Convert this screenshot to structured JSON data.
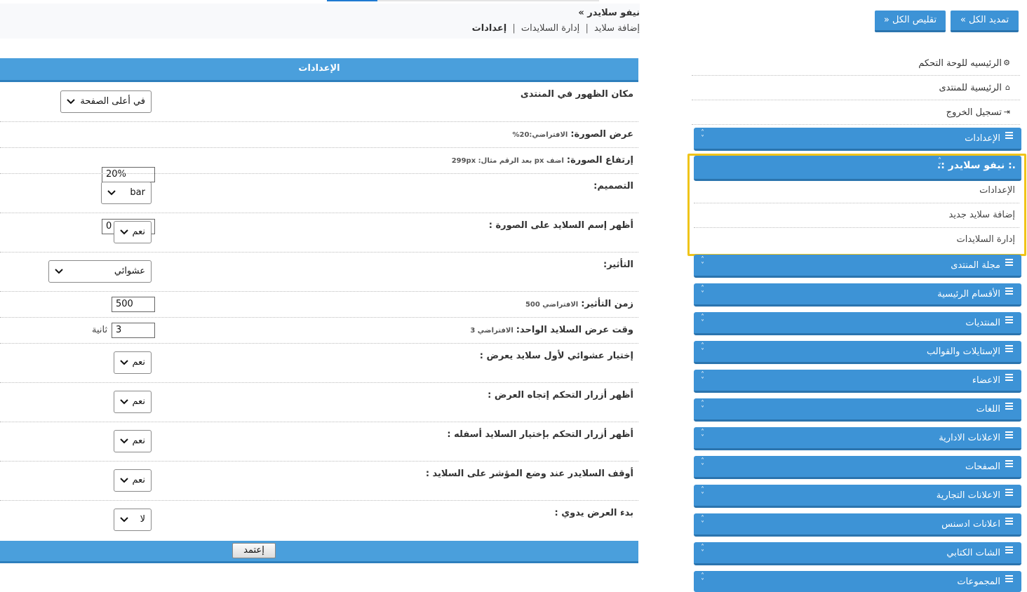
{
  "breadcrumb": {
    "title": "نيفو سلايدر »",
    "links": [
      "إضافة سلايد",
      "إدارة السلايدات"
    ],
    "separator": "|",
    "current": "إعدادات"
  },
  "panel": {
    "header": "الإعدادات",
    "submit_label": "إعتمد"
  },
  "settings": {
    "position": {
      "label": "مكان الظهور في المنتدى",
      "value": "في أعلى الصفحة"
    },
    "image_width": {
      "label": "عرض الصورة:",
      "hint": "الافتراضي:20%",
      "value": "20%"
    },
    "image_height": {
      "label": "إرتفاع الصورة:",
      "hint": "اضف px بعد الرقم مثال: 299px",
      "value": "0"
    },
    "design": {
      "label": "التصميم:",
      "value": "bar"
    },
    "show_name": {
      "label": "أظهر إسم السلايد على الصورة :",
      "value": "نعم"
    },
    "effect": {
      "label": "التأثير:",
      "value": "عشوائي"
    },
    "effect_time": {
      "label": "زمن التأثير:",
      "hint": "الافتراضي 500",
      "value": "500"
    },
    "slide_time": {
      "label": "وقت عرض السلايد الواحد:",
      "hint": "الافتراضي 3",
      "value": "3",
      "unit": "ثانية"
    },
    "random_first": {
      "label": "إختيار عشوائي لأول سلايد يعرض :",
      "value": "نعم"
    },
    "direction_buttons": {
      "label": "أظهر أزرار التحكم إتجاه العرض :",
      "value": "نعم"
    },
    "nav_buttons": {
      "label": "أظهر أزرار التحكم بإختيار السلايد أسفله :",
      "value": "نعم"
    },
    "pause_hover": {
      "label": "أوقف السلايدر عند وضع المؤشر على السلايد :",
      "value": "نعم"
    },
    "manual_start": {
      "label": "بدء العرض يدوي :",
      "value": "لا"
    }
  },
  "sidebar": {
    "expand_all": "تمديد الكل",
    "collapse_all": "تقليص الكل",
    "links": [
      {
        "label": "الرئيسيه للوحة التحكم",
        "icon": "cogs-icon"
      },
      {
        "label": "الرئيسية للمنتدى",
        "icon": "home-icon"
      },
      {
        "label": "تسجيل الخروج",
        "icon": "sign-out-icon"
      }
    ],
    "settings_category": "الإعدادات",
    "active_category": {
      "label": ".: نيفو سلايدر :.",
      "items": [
        "الإعدادات",
        "إضافة سلايد جديد",
        "إدارة السلايدات"
      ]
    },
    "categories": [
      "مجلة المنتدى",
      "الأقسام الرئيسية",
      "المنتديات",
      "الإستايلات والقوالب",
      "الاعضاء",
      "اللغات",
      "الاعلانات الادارية",
      "الصفحات",
      "الاعلانات التجارية",
      "اعلانات ادسنس",
      "الشات الكتابي",
      "المجموعات"
    ]
  },
  "colors": {
    "accent": "#4a9fdc",
    "accent_dark": "#2e7fbd",
    "highlight": "#f0c419"
  }
}
